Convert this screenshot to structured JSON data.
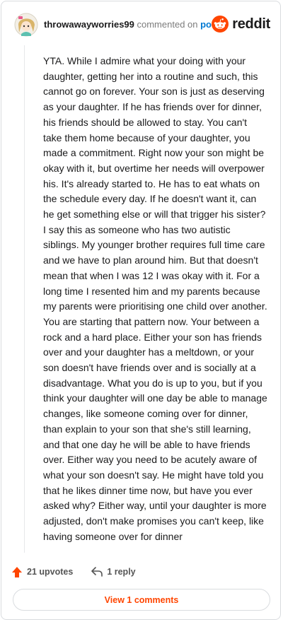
{
  "header": {
    "username": "throwawayworries99",
    "action_text": " commented on ",
    "post_link": "post",
    "brand": "reddit"
  },
  "comment": {
    "text": "YTA. While I admire what your doing with your daughter, getting her into a routine and such, this cannot go on forever. Your son is just as deserving as your daughter. If he has friends over for dinner, his friends should be allowed to stay. You can't take them home because of your daughter, you made a commitment. Right now your son might be okay with it, but overtime her needs will overpower his. It's already started to. He has to eat whats on the schedule every day. If he doesn't want it, can he get something else or will that trigger his sister? I say this as someone who has two autistic siblings. My younger brother requires full time care and we have to plan around him. But that doesn't mean that when I was 12 I was okay with it. For a long time I resented him and my parents because my parents were prioritising one child over another. You are starting that pattern now. Your between a rock and a hard place. Either your son has friends over and your daughter has a meltdown, or your son doesn't have friends over and is socially at a disadvantage. What you do is up to you, but if you think your daughter will one day be able to manage changes, like someone coming over for dinner, than explain to your son that she's still learning, and that one day he will be able to have friends over. Either way you need to be acutely aware of what your son doesn't say. He might have told you that he likes dinner time now, but have you ever asked why? Either way, until your daughter is more adjusted, don't make promises you can't keep, like having someone over for dinner"
  },
  "actions": {
    "upvotes": "21 upvotes",
    "reply": "1 reply",
    "view_comments": "View 1 comments"
  },
  "colors": {
    "accent": "#ff4500",
    "link": "#0079d3",
    "muted": "#7c7c7c"
  }
}
